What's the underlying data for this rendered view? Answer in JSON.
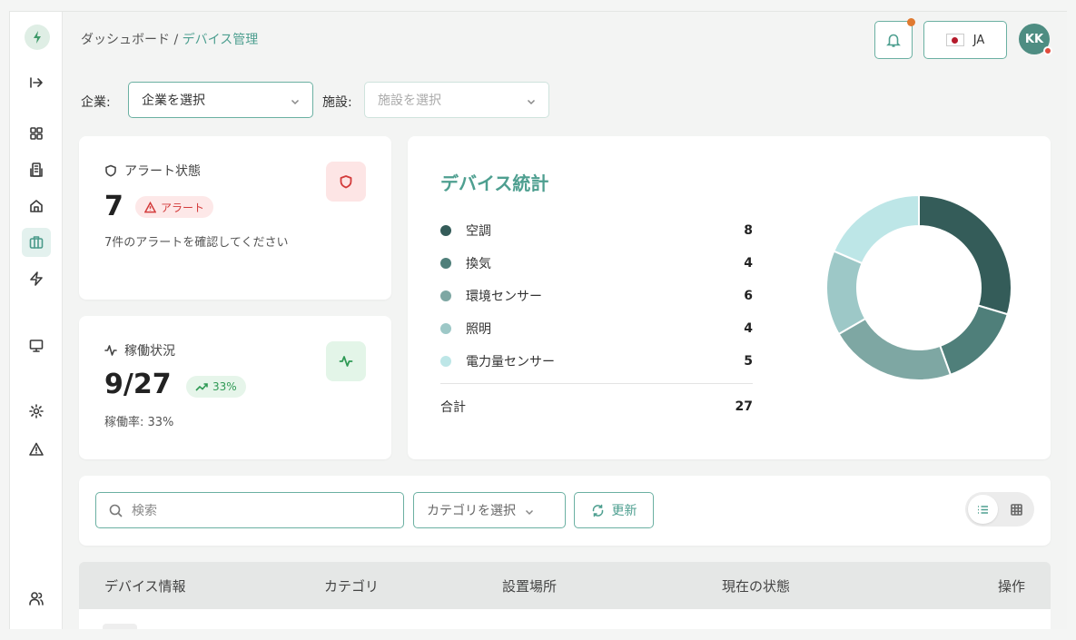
{
  "breadcrumb": {
    "root": "ダッシュボード",
    "separator": " / ",
    "current": "デバイス管理"
  },
  "header": {
    "lang_label": "JA",
    "avatar_initials": "KK"
  },
  "filters": {
    "company_label": "企業:",
    "company_value": "企業を選択",
    "facility_label": "施設:",
    "facility_placeholder": "施設を選択"
  },
  "alert_card": {
    "title": "アラート状態",
    "count": "7",
    "badge": "アラート",
    "description": "7件のアラートを確認してください"
  },
  "operation_card": {
    "title": "稼働状況",
    "value": "9/27",
    "badge": "33%",
    "rate": "稼働率: 33%"
  },
  "device_stats": {
    "title": "デバイス統計",
    "items": [
      {
        "label": "空調",
        "value": 8,
        "color": "#345c59"
      },
      {
        "label": "換気",
        "value": 4,
        "color": "#4f7f7a"
      },
      {
        "label": "環境センサー",
        "value": 6,
        "color": "#7ea7a3"
      },
      {
        "label": "照明",
        "value": 4,
        "color": "#9dc8c7"
      },
      {
        "label": "電力量センサー",
        "value": 5,
        "color": "#bde6e7"
      }
    ],
    "total_label": "合計",
    "total_value": "27"
  },
  "toolbar": {
    "search_placeholder": "検索",
    "category_placeholder": "カテゴリを選択",
    "refresh_label": "更新"
  },
  "table": {
    "headers": [
      "デバイス情報",
      "カテゴリ",
      "設置場所",
      "現在の状態",
      "操作"
    ]
  },
  "colors": {
    "accent": "#4e9f90",
    "alert": "#d33b3b",
    "success": "#2f9a55"
  },
  "icons": {
    "sidebar": [
      "collapse-sidebar-icon",
      "grid-icon",
      "building-icon",
      "home-icon",
      "briefcase-icon",
      "zap-icon",
      "monitor-icon",
      "settings-icon",
      "alert-triangle-icon",
      "users-icon"
    ]
  }
}
